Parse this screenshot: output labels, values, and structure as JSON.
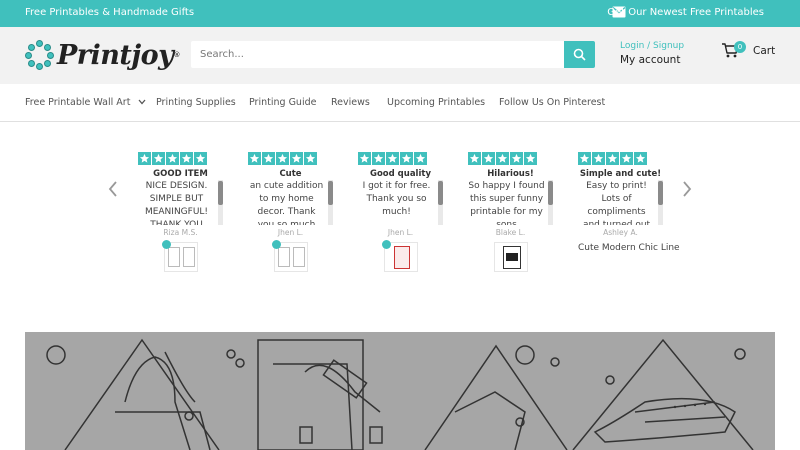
{
  "topbar": {
    "left_text": "Free Printables & Handmade Gifts",
    "right_text": "Get Our Newest Free Printables",
    "mail_icon": "mail-icon"
  },
  "header": {
    "logo_text": "Printjoy",
    "search_placeholder": "Search...",
    "login_text": "Login / Signup",
    "account_text": "My account",
    "cart_count": "0",
    "cart_label": "Cart"
  },
  "nav": {
    "items": [
      "Free Printable Wall Art",
      "Printing Supplies",
      "Printing Guide",
      "Reviews",
      "Upcoming Printables",
      "Follow Us On Pinterest"
    ]
  },
  "reviews": [
    {
      "title": "GOOD ITEM",
      "body": "NICE DESIGN. SIMPLE BUT MEANINGFUL! THANK YOU",
      "author": "Riza M.S.",
      "product": ""
    },
    {
      "title": "Cute",
      "body": "an cute addition to my home decor. Thank you so much",
      "author": "Jhen L.",
      "product": ""
    },
    {
      "title": "Good quality",
      "body": "I got it for free. Thank you so much!",
      "author": "Jhen L.",
      "product": ""
    },
    {
      "title": "Hilarious!",
      "body": "So happy I found this super funny printable for my sons",
      "author": "Blake L.",
      "product": ""
    },
    {
      "title": "Simple and cute!",
      "body": "Easy to print! Lots of compliments and turned out",
      "author": "Ashley A.",
      "product": "Cute Modern Chic Line"
    }
  ],
  "colors": {
    "accent": "#40c0bd",
    "hero_bg": "#a6a6a6",
    "header_bg": "#f2f2f2"
  }
}
